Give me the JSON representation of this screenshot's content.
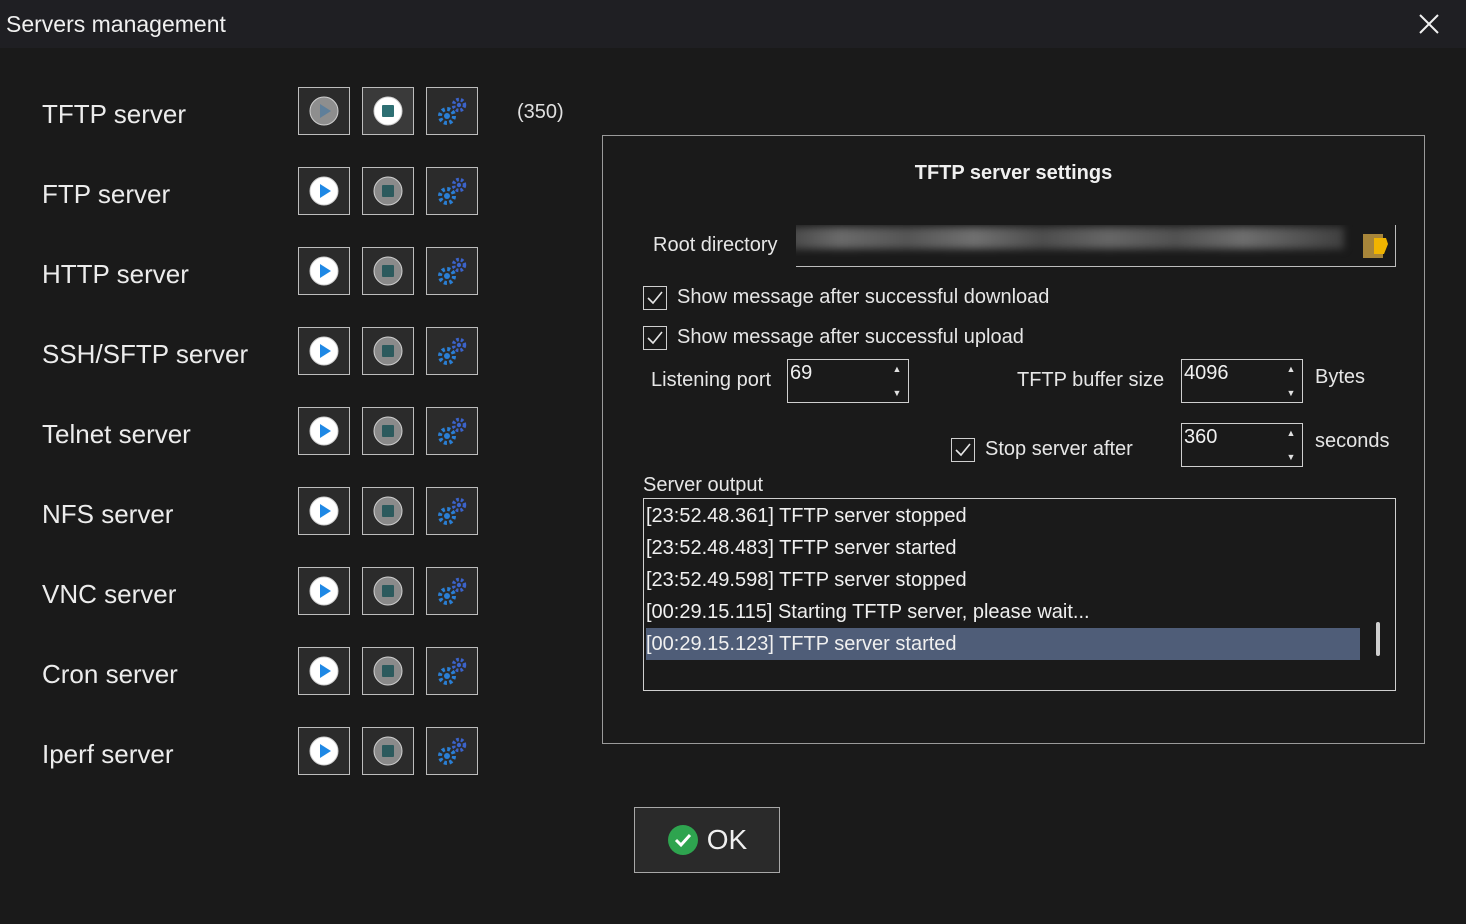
{
  "window": {
    "title": "Servers management"
  },
  "servers": [
    {
      "label": "TFTP server",
      "running": true
    },
    {
      "label": "FTP server",
      "running": false
    },
    {
      "label": "HTTP server",
      "running": false
    },
    {
      "label": "SSH/SFTP server",
      "running": false
    },
    {
      "label": "Telnet server",
      "running": false
    },
    {
      "label": "NFS server",
      "running": false
    },
    {
      "label": "VNC server",
      "running": false
    },
    {
      "label": "Cron server",
      "running": false
    },
    {
      "label": "Iperf server",
      "running": false
    }
  ],
  "tftp_count": "(350)",
  "settings": {
    "title": "TFTP server settings",
    "root_directory_label": "Root directory",
    "show_download_label": "Show message after successful download",
    "show_download_checked": true,
    "show_upload_label": "Show message after successful upload",
    "show_upload_checked": true,
    "listening_port_label": "Listening port",
    "listening_port_value": "69",
    "buffer_size_label": "TFTP buffer size",
    "buffer_size_value": "4096",
    "buffer_unit": "Bytes",
    "stop_after_label": "Stop server after",
    "stop_after_checked": true,
    "stop_after_value": "360",
    "stop_after_unit": "seconds",
    "output_label": "Server output",
    "output_lines": [
      "[23:52.48.361] TFTP server stopped",
      "[23:52.48.483] TFTP server started",
      "[23:52.49.598] TFTP server stopped",
      "[00:29.15.115] Starting TFTP server, please wait...",
      "[00:29.15.123] TFTP server started"
    ],
    "selected_line": 4
  },
  "ok_label": "OK",
  "colors": {
    "play_blue": "#1e88e5",
    "stop_teal": "#2e6f73",
    "gear_blue": "#2a7fd4",
    "selection": "#4f5d78",
    "ok_green": "#2ea44f"
  }
}
